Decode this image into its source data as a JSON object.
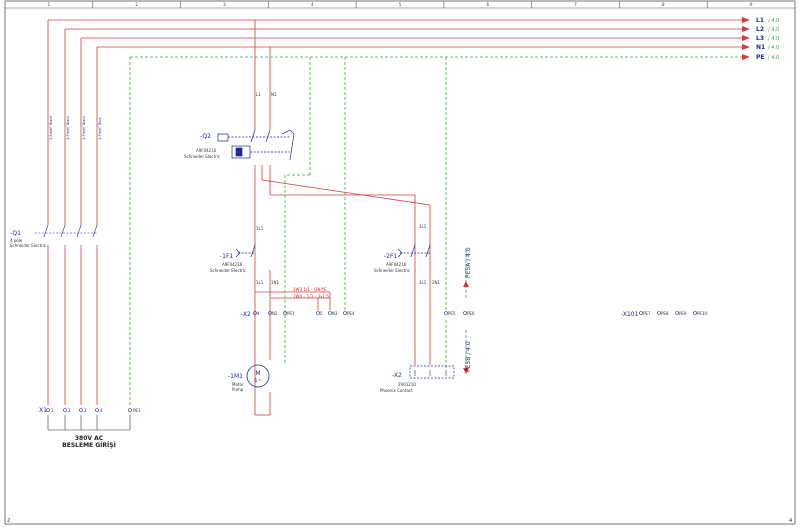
{
  "colors": {
    "power_line": "#d23b3b",
    "pe_line": "#3aa83a",
    "text_blue": "#1a2a9a",
    "annotation_red": "#d21f1f",
    "frame": "#555555"
  },
  "column_numbers": [
    "1",
    "2",
    "3",
    "4",
    "5",
    "6",
    "7",
    "8",
    "9"
  ],
  "buses": [
    {
      "name": "L1",
      "ref": "/ 4.0"
    },
    {
      "name": "L2",
      "ref": "/ 4.0"
    },
    {
      "name": "L3",
      "ref": "/ 4.0"
    },
    {
      "name": "N1",
      "ref": "/ 4.0"
    },
    {
      "name": "PE",
      "ref": "/ 4.0"
    }
  ],
  "devices": {
    "q1": {
      "tag": "-Q1",
      "lines": [
        "4 pole",
        "Schneider Electric"
      ]
    },
    "q2": {
      "tag": "-Q2",
      "lines": [
        "A9F04216",
        "Schneider Electric"
      ]
    },
    "f1": {
      "tag": "-1F1",
      "lines": [
        "A9F04216",
        "Schneider Electric"
      ]
    },
    "f2": {
      "tag": "-2F1",
      "lines": [
        "A9F04216",
        "Schneider Electric"
      ]
    },
    "m1": {
      "tag": "-1M1",
      "lines": [
        "Motor",
        "Pump"
      ]
    },
    "x2": {
      "tag": "-X2",
      "lines": [
        "2903210",
        "Phoenix Contact"
      ]
    },
    "k1": {
      "tag": "-X2"
    },
    "x101": {
      "tag": "-X101"
    },
    "x1": {
      "tag": "X1"
    }
  },
  "terminals": {
    "x1": [
      "1",
      "2",
      "3",
      "4",
      "PE1"
    ],
    "x2_left": [
      "4",
      "N2",
      "PE1"
    ],
    "x2_mid": [
      "5",
      "N3",
      "PE4"
    ],
    "x2_right": [
      "PE5",
      "PE6"
    ],
    "x101": [
      "PE7",
      "PE8",
      "PE9",
      "PE10"
    ]
  },
  "wire_labels": {
    "l1": "L1",
    "n1": "N1",
    "l11": "1L1",
    "l1n": "1N1",
    "l21": "2L1",
    "l2n": "2N1",
    "l1b": "1L1"
  },
  "red_annotations": [
    "1W3 1/1 – GN/YE",
    "1W4 – 1/3 – 3x1.5"
  ],
  "motor_symbol": {
    "letter": "M",
    "phase": "1~"
  },
  "pe_arrows": {
    "top": "PE5A / 4.0",
    "bottom": "PE5B / 4.0"
  },
  "caption": {
    "line1": "380V AC",
    "line2": "BESLEME GİRİŞİ"
  },
  "page_corner": {
    "left": "2",
    "right": "4"
  }
}
